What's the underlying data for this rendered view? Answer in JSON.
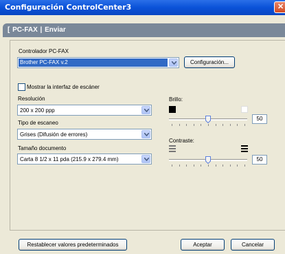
{
  "window": {
    "title": "Configuración ControlCenter3",
    "close_glyph": "✕"
  },
  "tab_header": "[ PC-FAX | Enviar",
  "driver": {
    "label": "Controlador PC-FAX",
    "selected": "Brother PC-FAX v.2",
    "config_button": "Configuración..."
  },
  "show_scanner_interface": {
    "label": "Mostrar la interfaz de escáner",
    "checked": false
  },
  "resolution": {
    "label": "Resolución",
    "selected": "200 x 200 ppp"
  },
  "scan_type": {
    "label": "Tipo de escaneo",
    "selected": "Grises (Difusión de errores)"
  },
  "document_size": {
    "label": "Tamaño documento",
    "selected": "Carta 8 1/2 x 11 pda (215.9 x 279.4 mm)"
  },
  "brightness": {
    "label": "Brillo:",
    "value": "50",
    "level": 0.5
  },
  "contrast": {
    "label": "Contraste:",
    "value": "50",
    "level": 0.5
  },
  "footer": {
    "restore_button": "Restablecer valores predeterminados",
    "accept_button": "Aceptar",
    "cancel_button": "Cancelar"
  },
  "colors": {
    "titlebar": "#0a52d8",
    "selection": "#316ac5",
    "tab_header": "#7a8899",
    "dialog_bg": "#ece9d8"
  },
  "icons": {
    "close": "close-icon",
    "dropdown": "chevron-down-icon",
    "brightness_low": "dark-square-icon",
    "brightness_high": "light-square-icon",
    "contrast_low": "low-contrast-icon",
    "contrast_high": "high-contrast-icon"
  }
}
